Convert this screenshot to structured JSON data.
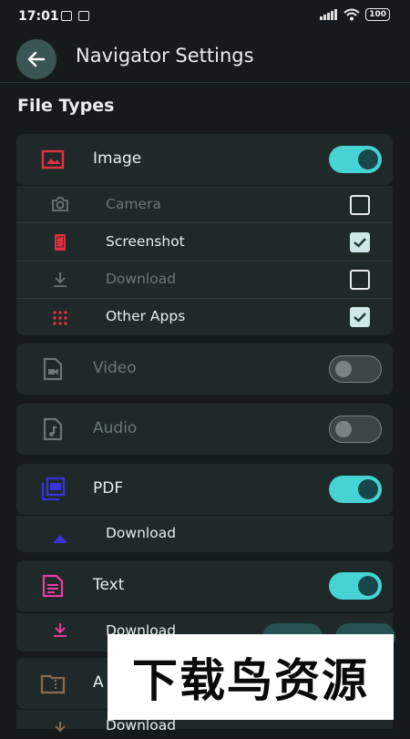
{
  "status": {
    "time": "17:01",
    "battery": "100"
  },
  "header": {
    "title": "Navigator Settings"
  },
  "section": {
    "title": "File Types"
  },
  "image": {
    "label": "Image",
    "on": true,
    "subs": [
      {
        "label": "Camera",
        "checked": false,
        "enabled": false
      },
      {
        "label": "Screenshot",
        "checked": true,
        "enabled": true
      },
      {
        "label": "Download",
        "checked": false,
        "enabled": false
      },
      {
        "label": "Other Apps",
        "checked": true,
        "enabled": true
      }
    ]
  },
  "video": {
    "label": "Video",
    "on": false
  },
  "audio": {
    "label": "Audio",
    "on": false
  },
  "pdf": {
    "label": "PDF",
    "on": true,
    "sub_label": "Download"
  },
  "text": {
    "label": "Text",
    "on": true,
    "sub_label": "Download"
  },
  "archive": {
    "label": "A",
    "sub_label": "Download"
  },
  "watermark": "下载鸟资源",
  "colors": {
    "accent": "#45d3d3",
    "image": "#e0323e",
    "pdf": "#3834d6",
    "text": "#e33ea4",
    "archive": "#8c6a4c"
  }
}
